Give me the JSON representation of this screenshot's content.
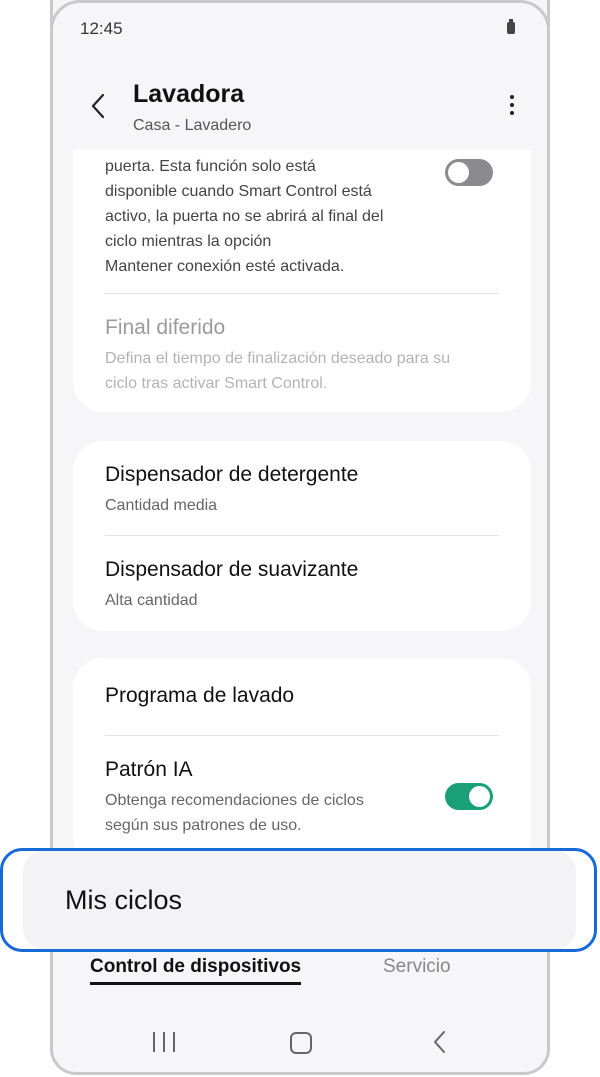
{
  "status_bar": {
    "time": "12:45"
  },
  "header": {
    "title": "Lavadora",
    "subtitle": "Casa - Lavadero"
  },
  "settings": {
    "door_description": [
      "puerta. Esta función solo está",
      "disponible cuando Smart Control está",
      "activo, la puerta no se abrirá al final del",
      "ciclo mientras la opción",
      "Mantener conexión esté activada."
    ],
    "door_toggle_on": false,
    "final_diferido": {
      "label": "Final diferido",
      "description_line1": "Defina el tiempo de finalización deseado para su",
      "description_line2": "ciclo tras activar Smart Control."
    },
    "detergent": {
      "label": "Dispensador de detergente",
      "value": "Cantidad media"
    },
    "softener": {
      "label": "Dispensador de suavizante",
      "value": "Alta cantidad"
    },
    "wash_program": {
      "label": "Programa de lavado"
    },
    "ai_pattern": {
      "label": "Patrón IA",
      "description_line1": "Obtenga recomendaciones de ciclos",
      "description_line2": "según sus patrones de uso.",
      "toggle_on": true
    },
    "my_cycles": {
      "label": "Mis ciclos"
    }
  },
  "tabs": [
    {
      "label": "Control de dispositivos",
      "active": true
    },
    {
      "label": "Servicio",
      "active": false
    }
  ],
  "colors": {
    "accent_green": "#1a9f76",
    "highlight_blue": "#1769d6"
  },
  "icons": {
    "back": "back-arrow-icon",
    "more": "more-options-icon",
    "nav_recents": "recents-icon",
    "nav_home": "home-icon",
    "nav_back": "nav-back-icon"
  }
}
